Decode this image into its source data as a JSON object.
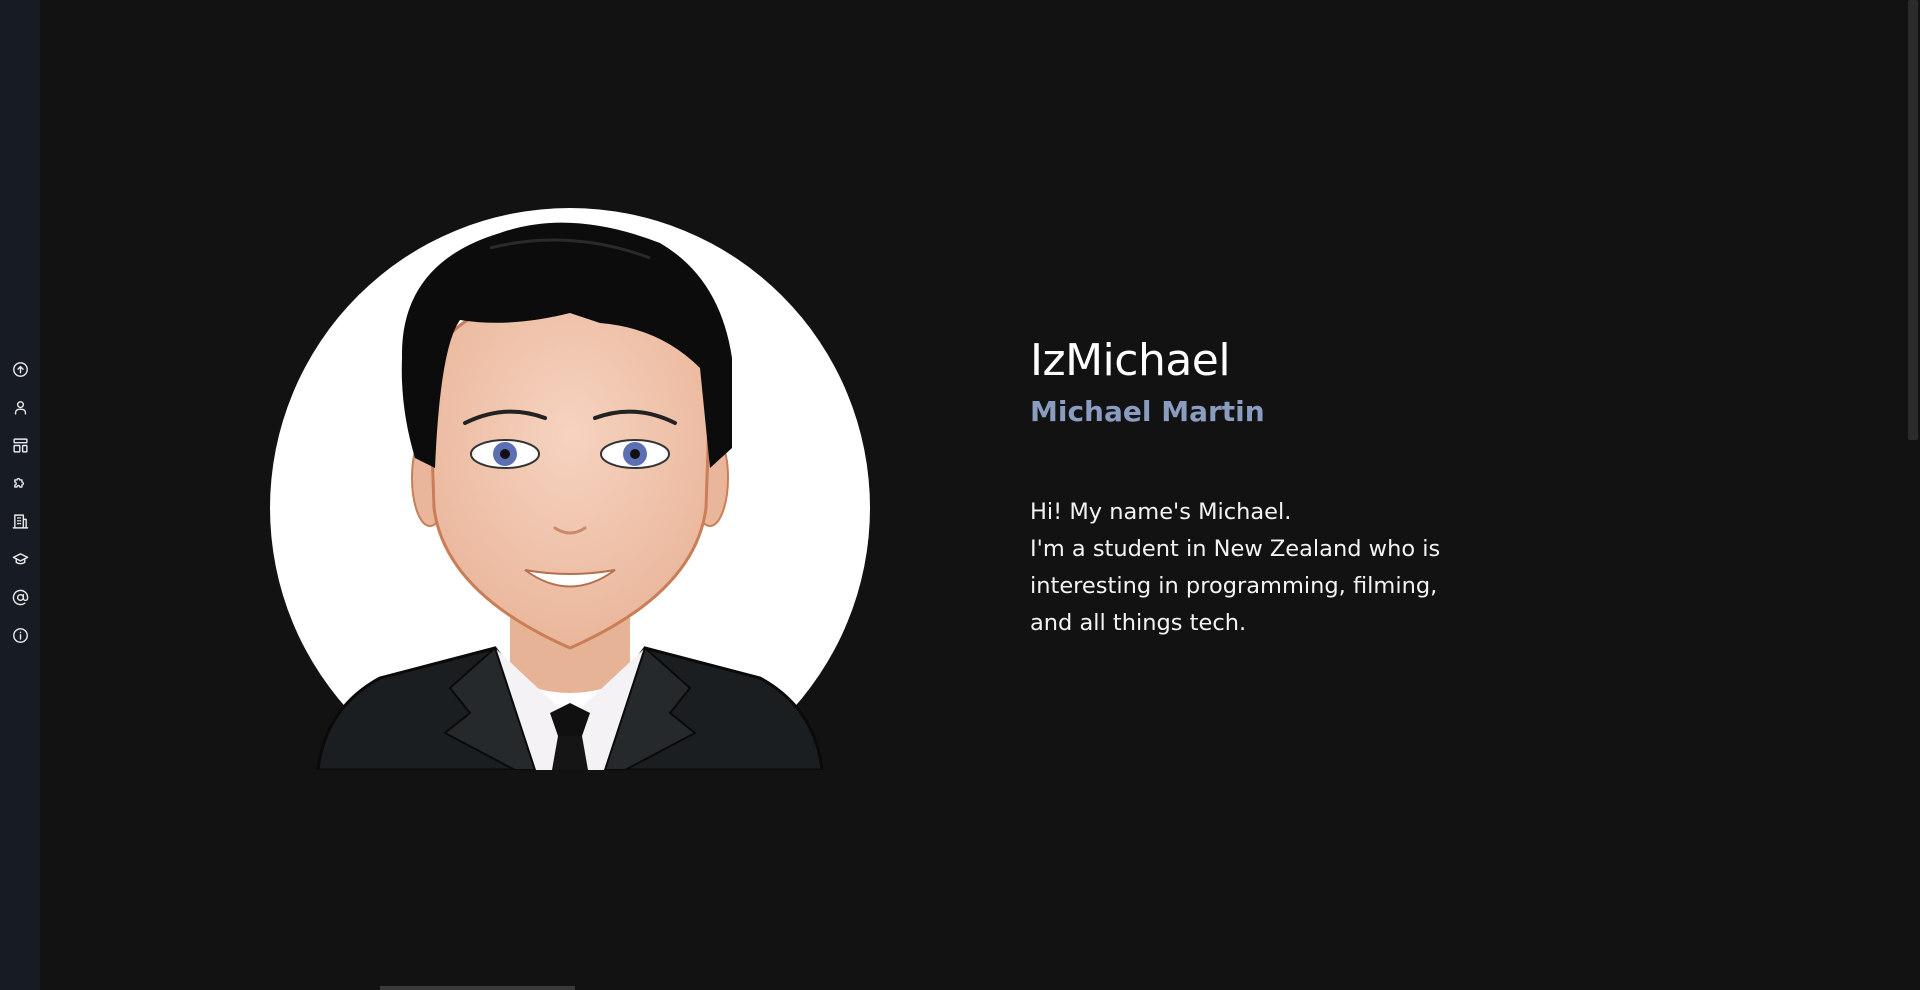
{
  "sidebar": {
    "items": [
      {
        "icon": "arrow-up-circle-icon",
        "name": "nav-top"
      },
      {
        "icon": "user-icon",
        "name": "nav-about"
      },
      {
        "icon": "layout-icon",
        "name": "nav-projects"
      },
      {
        "icon": "puzzle-icon",
        "name": "nav-skills"
      },
      {
        "icon": "building-icon",
        "name": "nav-experience"
      },
      {
        "icon": "graduation-cap-icon",
        "name": "nav-education"
      },
      {
        "icon": "at-sign-icon",
        "name": "nav-contact"
      },
      {
        "icon": "info-icon",
        "name": "nav-info"
      }
    ]
  },
  "profile": {
    "handle": "IzMichael",
    "name": "Michael Martin",
    "bio_lines": [
      "Hi! My name's Michael.",
      "I'm a student in New Zealand who is",
      "interesting in programming, filming,",
      "and all things tech."
    ]
  },
  "colors": {
    "background": "#121212",
    "sidebar": "#161b24",
    "accent": "#8a9cc0"
  }
}
